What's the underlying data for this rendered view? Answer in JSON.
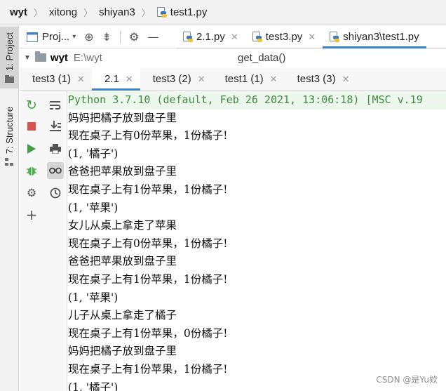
{
  "breadcrumb": [
    "wyt",
    "xitong",
    "shiyan3",
    "test1.py"
  ],
  "side_panel": {
    "project_label": "1: Project",
    "structure_label": "7: Structure"
  },
  "project_toolbar": {
    "title": "Proj..."
  },
  "editor_tabs": [
    {
      "label": "2.1.py",
      "active": false
    },
    {
      "label": "test3.py",
      "active": false
    },
    {
      "label": "shiyan3\\test1.py",
      "active": true
    }
  ],
  "project_tree": {
    "root_name": "wyt",
    "root_path": "E:\\wyt"
  },
  "editor_breadcrumb": "get_data()",
  "run_tabs": [
    {
      "label": "test3 (1)",
      "active": false
    },
    {
      "label": "2.1",
      "active": true
    },
    {
      "label": "test3 (2)",
      "active": false
    },
    {
      "label": "test1 (1)",
      "active": false
    },
    {
      "label": "test3 (3)",
      "active": false
    }
  ],
  "console": {
    "header": "Python 3.7.10 (default, Feb 26 2021, 13:06:18) [MSC v.19",
    "lines": [
      "妈妈把橘子放到盘子里",
      "现在桌子上有0份苹果，1份橘子!",
      "(1, '橘子')",
      "爸爸把苹果放到盘子里",
      "现在桌子上有1份苹果，1份橘子!",
      "(1, '苹果')",
      "女儿从桌上拿走了苹果",
      "现在桌子上有0份苹果，1份橘子!",
      "爸爸把苹果放到盘子里",
      "现在桌子上有1份苹果，1份橘子!",
      "(1, '苹果')",
      "儿子从桌上拿走了橘子",
      "现在桌子上有1份苹果，0份橘子!",
      "妈妈把橘子放到盘子里",
      "现在桌子上有1份苹果，1份橘子!",
      "(1, '橘子')"
    ]
  },
  "watermark": "CSDN @是Yu欸",
  "icons": [
    "python-file-icon",
    "project-view-icon",
    "target-icon",
    "collapse-icon",
    "gear-icon",
    "minimize-icon",
    "folder-icon",
    "rerun-icon",
    "stop-icon",
    "run-icon",
    "debug-icon",
    "settings-icon",
    "add-icon",
    "soft-wrap-icon",
    "scroll-to-end-icon",
    "print-icon",
    "show-variables-icon",
    "history-icon"
  ],
  "colors": {
    "accent": "#4083c9",
    "console_header_text": "#3d8a3d",
    "rerun": "#3fa047",
    "stop": "#d9534f",
    "run": "#3fa047",
    "debug": "#4caf50"
  }
}
